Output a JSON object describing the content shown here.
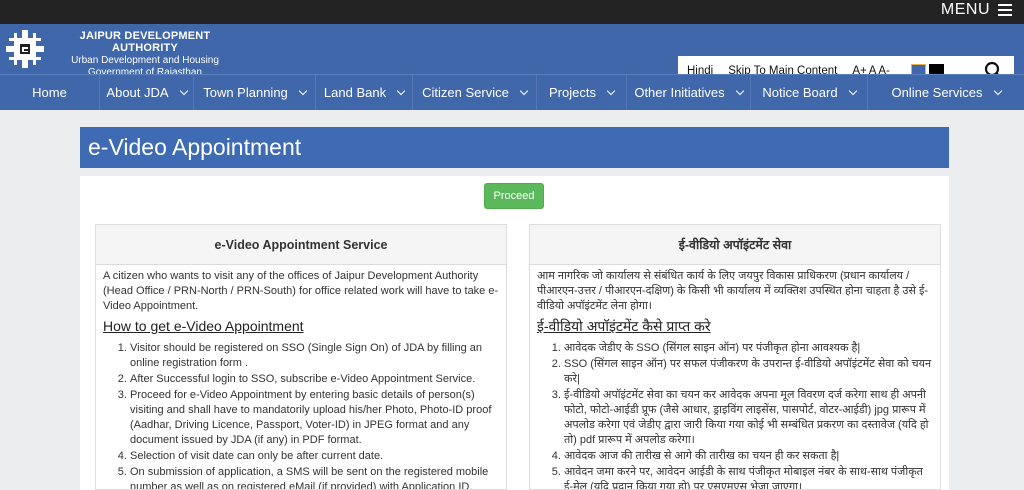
{
  "topbar": {
    "menu_label": "MENU"
  },
  "header": {
    "org_line1": "JAIPUR DEVELOPMENT AUTHORITY",
    "org_line2": "Urban Development and Housing",
    "org_line3": "Government of Rajasthan",
    "tools": {
      "hindi": "Hindi",
      "skip": "Skip To Main Content",
      "font_plus": "A+",
      "font_normal": "A",
      "font_minus": "A-"
    }
  },
  "nav": [
    {
      "label": "Home",
      "dropdown": false
    },
    {
      "label": "About JDA",
      "dropdown": true
    },
    {
      "label": "Town Planning",
      "dropdown": true
    },
    {
      "label": "Land Bank",
      "dropdown": true
    },
    {
      "label": "Citizen Service",
      "dropdown": true
    },
    {
      "label": "Projects",
      "dropdown": true
    },
    {
      "label": "Other Initiatives",
      "dropdown": true
    },
    {
      "label": "Notice Board",
      "dropdown": true
    },
    {
      "label": "Online Services",
      "dropdown": true
    }
  ],
  "page": {
    "title": "e-Video Appointment",
    "proceed_label": "Proceed"
  },
  "english": {
    "heading": "e-Video Appointment Service",
    "intro": "A citizen who wants to visit any of the offices of Jaipur Development Authority (Head Office / PRN-North / PRN-South) for office related work will have to take e-Video Appointment.",
    "howto": "How to get e-Video Appointment",
    "steps": [
      "Visitor should be registered on SSO (Single Sign On) of JDA by filling an online registration form .",
      "After Successful login to SSO, subscribe e-Video Appointment Service.",
      "Proceed for e-Video Appointment by entering basic details of person(s) visiting and shall have to mandatorily upload his/her Photo, Photo-ID proof (Aadhar, Driving Licence, Passport, Voter-ID) in JPEG format and any document issued by JDA (if any) in PDF format.",
      "Selection of visit date can only be after current date.",
      "On submission of application, a SMS will be sent on the registered mobile number as well as on registered eMail (if provided) with Application ID."
    ]
  },
  "hindi": {
    "heading": "ई-वीडियो अपॉइंटमेंट सेवा",
    "intro": "आम नागरिक जो कार्यालय से संबंधित कार्य के लिए जयपुर विकास प्राधिकरण (प्रधान कार्यालय / पीआरएन-उत्तर / पीआरएन-दक्षिण) के किसी भी कार्यालय में व्यक्तिश उपस्थित होना चाहता है उसे ई-वीडियो अपॉइंटमेंट लेना होगा।",
    "howto": "ई-वीडियो अपॉइंटमेंट कैसे प्राप्त करे",
    "steps": [
      "आवेदक जेडीए के SSO (सिंगल साइन ऑन) पर पंजीकृत होना आवश्यक है|",
      "SSO (सिंगल साइन ऑन) पर सफल पंजीकरण के उपरान्त ई-वीडियो अपॉइंटमेंट सेवा को चयन करे|",
      "ई-वीडियो अपॉइंटमेंट सेवा का चयन कर आवेदक अपना मूल विवरण दर्ज करेगा साथ ही अपनी फोटो, फोटो-आईडी प्रूफ (जैसे आधार, ड्राइविंग लाइसेंस, पासपोर्ट, वोटर-आईडी) jpg प्रारूप में अपलोड करेगा एवं जेडीए द्वारा जारी किया गया कोई भी सम्बंधित प्रकरण का दस्तावेज (यदि हो तो) pdf प्रारूप में अपलोड करेगा।",
      "आवेदक आज की तारीख से आगे की तारीख का चयन ही कर सकता है|",
      "आवेदन जमा करने पर, आवेदन आईडी के साथ पंजीकृत मोबाइल नंबर के साथ-साथ पंजीकृत ई-मेल (यदि प्रदान किया गया हो) पर एसएमएस भेजा जाएगा।"
    ]
  },
  "colors": {
    "header_blue": "#3f67a9",
    "title_blue": "#3e6bb4",
    "proceed_green": "#5cb85c",
    "topbar": "#232323"
  }
}
